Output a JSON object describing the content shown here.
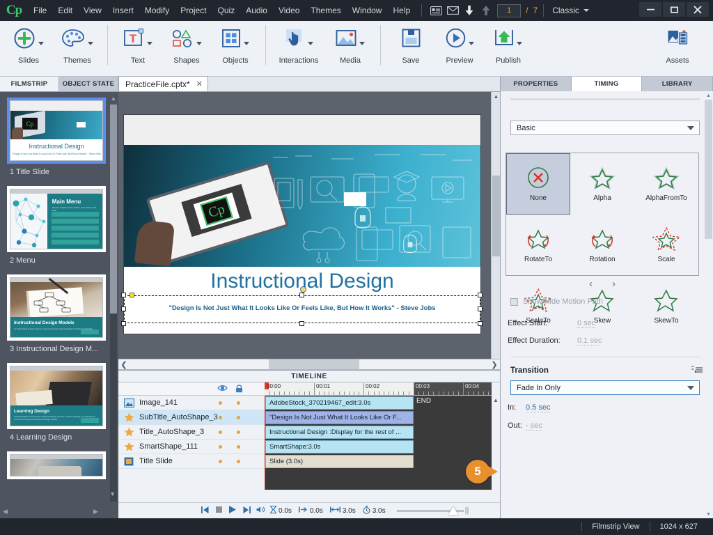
{
  "app": {
    "logo": "Cp",
    "menus": [
      "File",
      "Edit",
      "View",
      "Insert",
      "Modify",
      "Project",
      "Quiz",
      "Audio",
      "Video",
      "Themes",
      "Window",
      "Help"
    ],
    "toolbar_icons": [
      "slide-notes-icon",
      "mail-icon",
      "download-icon",
      "upload-icon"
    ],
    "page_current": "1",
    "page_sep": "/",
    "page_total": "7",
    "workspace": "Classic",
    "window_buttons": {
      "minimize": "—",
      "maximize": "❐",
      "close": "✕"
    }
  },
  "ribbon": {
    "groups": [
      {
        "label": "Slides",
        "icon": "plus-circle-icon",
        "has_caret": true
      },
      {
        "label": "Themes",
        "icon": "palette-icon",
        "has_caret": true
      },
      {
        "label": "Text",
        "icon": "text-box-icon",
        "has_caret": true
      },
      {
        "label": "Shapes",
        "icon": "shapes-icon",
        "has_caret": true
      },
      {
        "label": "Objects",
        "icon": "objects-grid-icon",
        "has_caret": true
      },
      {
        "label": "Interactions",
        "icon": "hand-click-icon",
        "has_caret": true
      },
      {
        "label": "Media",
        "icon": "image-icon",
        "has_caret": true
      },
      {
        "label": "Save",
        "icon": "floppy-disk-icon",
        "has_caret": false
      },
      {
        "label": "Preview",
        "icon": "play-circle-icon",
        "has_caret": true
      },
      {
        "label": "Publish",
        "icon": "publish-up-arrow-icon",
        "has_caret": true
      },
      {
        "label": "Assets",
        "icon": "assets-icon",
        "has_caret": false
      }
    ]
  },
  "left_panel": {
    "tabs": [
      {
        "label": "FILMSTRIP",
        "selected": false
      },
      {
        "label": "OBJECT STATE",
        "selected": true
      }
    ],
    "slides": [
      {
        "caption": "1 Title Slide",
        "title": "Instructional Design",
        "subtitle": "\"Design Is Not Just What It Looks Like Or Feels Like, But How It Works\" - Steve Jobs",
        "selected": true,
        "kind": "hero-title"
      },
      {
        "caption": "2 Menu",
        "title": "Main Menu",
        "subtitle": "Use the module menu to learn more about each topic.",
        "selected": false,
        "kind": "menu"
      },
      {
        "caption": "3 Instructional Design M...",
        "title": "Instructional Design Models",
        "subtitle": "An instructional design model is a tool or framework used to develop instructional materials.",
        "selected": false,
        "kind": "photo-teal"
      },
      {
        "caption": "4 Learning Design",
        "title": "Learning Design",
        "subtitle": "Learning design is the process of determining the structure, content, strategy, and assessment process to promote successful knowledge transfer.",
        "selected": false,
        "kind": "photo-teal"
      },
      {
        "caption": "",
        "title": "",
        "subtitle": "",
        "selected": false,
        "kind": "photo-partial"
      }
    ]
  },
  "document_tab": {
    "label": "PracticeFile.cptx*",
    "close": "✕"
  },
  "canvas": {
    "slide_title": "Instructional Design",
    "slide_subtitle": "\"Design Is Not Just What It Looks Like Or Feels Like, But How It Works\" - Steve Jobs",
    "selected_object": "SubTitle_AutoShape_3",
    "scroll_left_arrow": "❮",
    "scroll_right_arrow": "❯"
  },
  "timeline": {
    "title": "TIMELINE",
    "eye_icon": "eye-icon",
    "lock_icon": "lock-icon",
    "ruler_labels": [
      "00:00",
      "00:01",
      "00:02",
      "00:03",
      "00:04"
    ],
    "end_marker": "END",
    "rows": [
      {
        "name": "Image_141",
        "icon": "image-thumb-icon",
        "bar_label": "AdobeStock_370219467_edit:3.0s",
        "bar_style": "cyan",
        "selected": false
      },
      {
        "name": "SubTitle_AutoShape_3",
        "icon": "star-icon",
        "bar_label": "\"Design Is Not Just What It Looks Like Or F...",
        "bar_style": "blue",
        "selected": true
      },
      {
        "name": "Title_AutoShape_3",
        "icon": "star-icon",
        "bar_label": "Instructional Design :Display for the rest of ...",
        "bar_style": "cyan",
        "selected": false
      },
      {
        "name": "SmartShape_111",
        "icon": "star-icon",
        "bar_label": "SmartShape:3.0s",
        "bar_style": "cyan",
        "selected": false
      },
      {
        "name": "Title Slide",
        "icon": "slide-icon",
        "bar_label": "Slide (3.0s)",
        "bar_style": "tan",
        "selected": false
      }
    ],
    "transport": [
      "skip-start-icon",
      "stop-icon",
      "play-icon",
      "skip-end-icon",
      "volume-icon"
    ],
    "fields": [
      {
        "icon": "hourglass-icon",
        "value": "0.0s"
      },
      {
        "icon": "arrow-right-icon",
        "value": "0.0s"
      },
      {
        "icon": "span-arrow-icon",
        "value": "3.0s"
      },
      {
        "icon": "stopwatch-icon",
        "value": "3.0s"
      }
    ]
  },
  "right_panel": {
    "tabs": [
      {
        "label": "PROPERTIES",
        "selected": false
      },
      {
        "label": "TIMING",
        "selected": true
      },
      {
        "label": "LIBRARY",
        "selected": false
      }
    ],
    "effect_category": "Basic",
    "effects": [
      {
        "label": "None",
        "icon": "none-circle-x-icon",
        "selected": true
      },
      {
        "label": "Alpha",
        "icon": "star-alpha-icon",
        "selected": false
      },
      {
        "label": "AlphaFromTo",
        "icon": "star-alpha-fromto-icon",
        "selected": false
      },
      {
        "label": "RotateTo",
        "icon": "star-rotateto-icon",
        "selected": false
      },
      {
        "label": "Rotation",
        "icon": "star-rotation-icon",
        "selected": false
      },
      {
        "label": "Scale",
        "icon": "star-scale-icon",
        "selected": false
      },
      {
        "label": "ScaleTo",
        "icon": "star-scaleto-icon",
        "selected": false
      },
      {
        "label": "Skew",
        "icon": "star-skew-icon",
        "selected": false
      },
      {
        "label": "SkewTo",
        "icon": "star-skewto-icon",
        "selected": false
      }
    ],
    "nav_prev": "‹",
    "nav_next": "›",
    "motion_path_label": "Show/Hide Motion Path",
    "effect_start_label": "Effect Start:",
    "effect_start_value": "0 sec",
    "effect_duration_label": "Effect Duration:",
    "effect_duration_value": "0.1 sec",
    "transition_title": "Transition",
    "transition_value": "Fade In Only",
    "in_label": "In:",
    "in_value": "0.5 sec",
    "out_label": "Out:",
    "out_value": "- sec"
  },
  "callout": {
    "number": "5"
  },
  "status_bar": {
    "view_mode": "Filmstrip View",
    "dimensions": "1024 x 627"
  },
  "colors": {
    "chrome_dark": "#21262e",
    "panel_bg": "#eff1f6",
    "accent_blue": "#3f83c5",
    "accent_orange": "#e8902e",
    "selection_blue": "#5b8ef0",
    "cp_green": "#3ec96a",
    "teal": "#1d7b86"
  }
}
